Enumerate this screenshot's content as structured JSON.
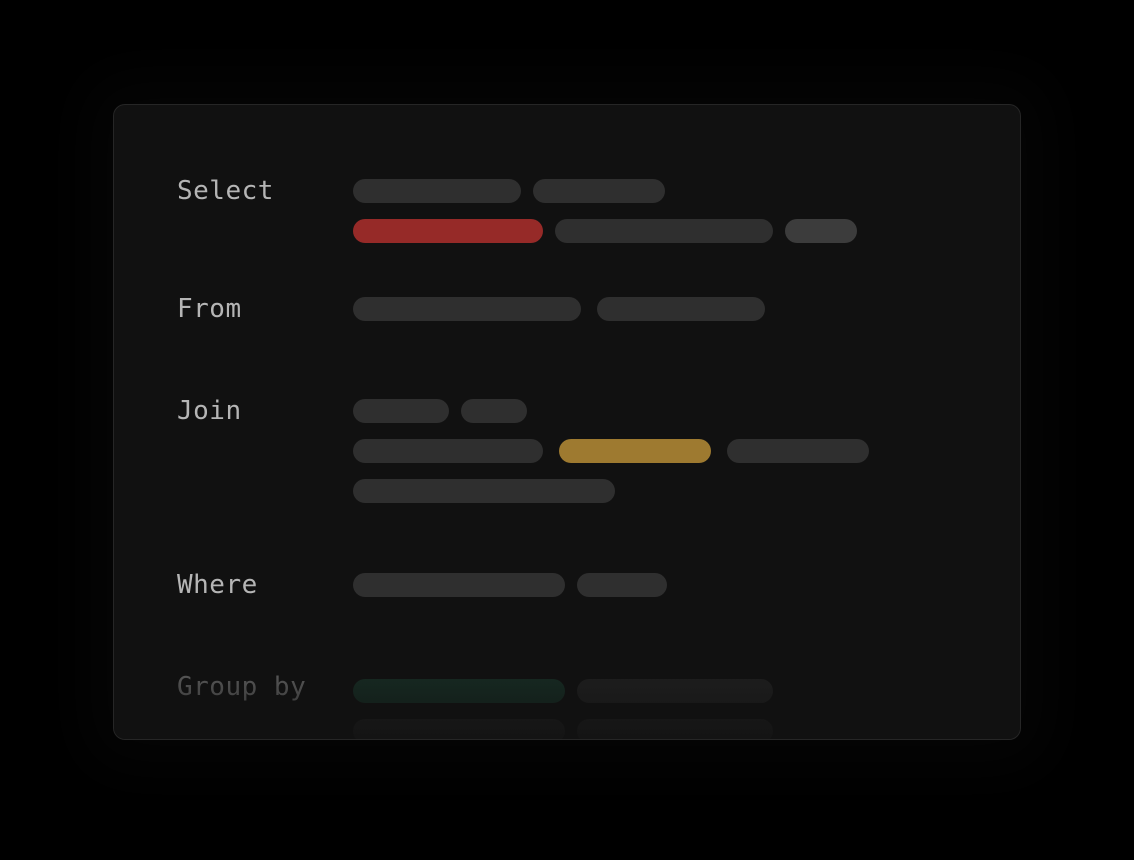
{
  "sections": [
    {
      "label": "Select"
    },
    {
      "label": "From"
    },
    {
      "label": "Join"
    },
    {
      "label": "Where"
    },
    {
      "label": "Group by"
    }
  ],
  "colors": {
    "background": "#000000",
    "card": "#111111",
    "pill_default": "#2f2f2f",
    "pill_highlight_red": "#962a28",
    "pill_highlight_gold": "#9e7a30",
    "pill_highlight_green": "#1d4a38",
    "label_text": "#b5b5b5"
  }
}
